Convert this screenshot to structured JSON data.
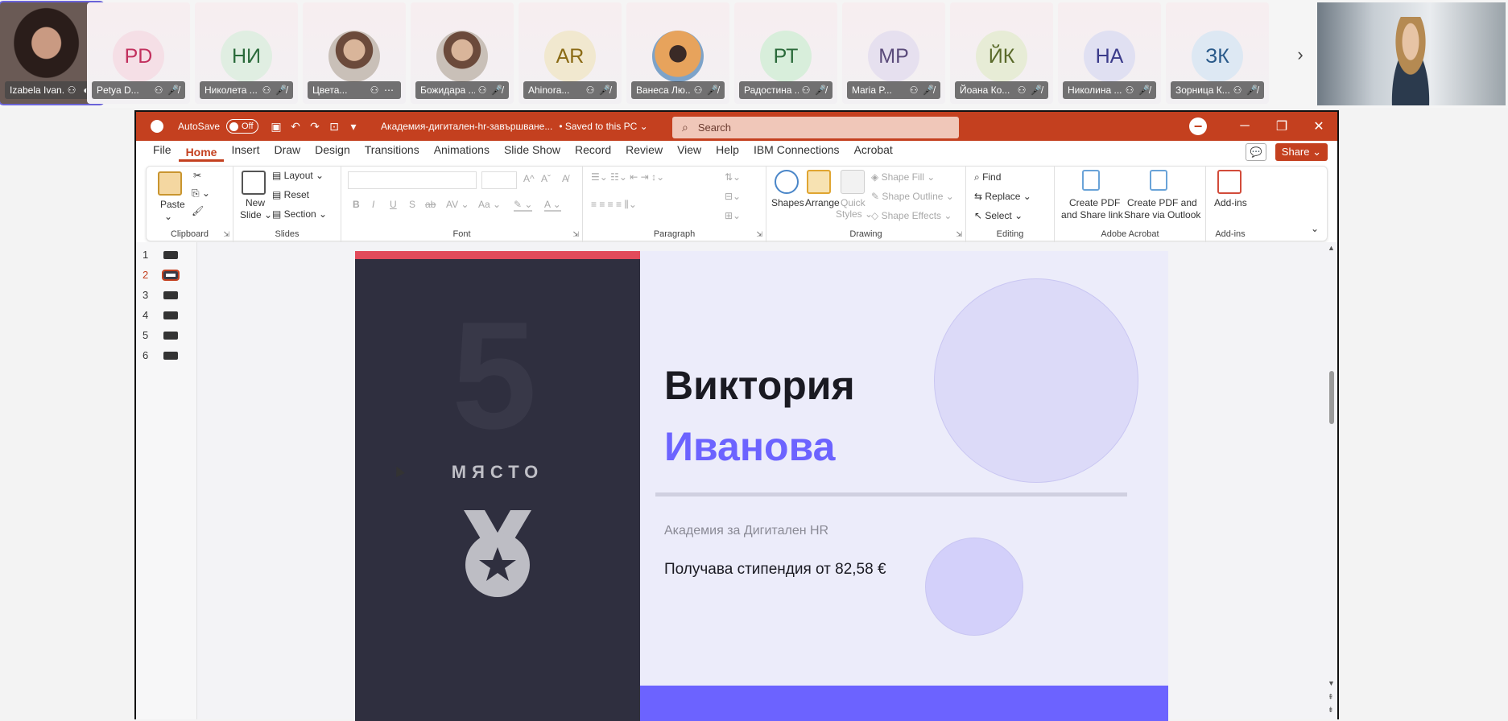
{
  "participants": [
    {
      "initials": "",
      "name": "Izabela Ivan...",
      "kind": "video",
      "mic": "◐"
    },
    {
      "initials": "PD",
      "name": "Petya D...",
      "color": "#c2305e",
      "bg": "#f5dfe6",
      "mic": "🎤̸"
    },
    {
      "initials": "НИ",
      "name": "Николета ...",
      "color": "#2a6a3a",
      "bg": "#e0eee2",
      "mic": "🎤̸"
    },
    {
      "initials": "",
      "name": "Цвета...",
      "kind": "photo",
      "mic": "⋯"
    },
    {
      "initials": "",
      "name": "Божидара ...",
      "kind": "photo",
      "mic": "🎤̸"
    },
    {
      "initials": "AR",
      "name": "Ahinora...",
      "color": "#8a6a14",
      "bg": "#f1e8cf",
      "mic": "🎤̸"
    },
    {
      "initials": "",
      "name": "Ванеса Лю...",
      "kind": "sunset",
      "mic": "🎤̸"
    },
    {
      "initials": "РТ",
      "name": "Радостина ...",
      "color": "#2a6a3a",
      "bg": "#d8eedb",
      "mic": "🎤̸"
    },
    {
      "initials": "МР",
      "name": "Maria P...",
      "color": "#5a4a7a",
      "bg": "#e6e0ef",
      "mic": "🎤̸"
    },
    {
      "initials": "ЙК",
      "name": "Йоана Ко...",
      "color": "#5a6a2a",
      "bg": "#e7ecd6",
      "mic": "🎤̸"
    },
    {
      "initials": "НА",
      "name": "Николина ...",
      "color": "#3a3a8a",
      "bg": "#e0e0f2",
      "mic": "🎤̸"
    },
    {
      "initials": "ЗК",
      "name": "Зорница К...",
      "color": "#2a5a8a",
      "bg": "#dde8f3",
      "mic": "🎤̸"
    }
  ],
  "strip_next_icon": "›",
  "titlebar": {
    "autosave_label": "AutoSave",
    "toggle_label": "Off",
    "doc_title": "Академия-дигитален-hr-завършване...",
    "saved_status": "• Saved to this PC ⌄",
    "search_placeholder": "Search",
    "minimize": "─",
    "restore": "❐",
    "close": "✕",
    "recording_icon": "−"
  },
  "menu": {
    "items": [
      "File",
      "Home",
      "Insert",
      "Draw",
      "Design",
      "Transitions",
      "Animations",
      "Slide Show",
      "Record",
      "Review",
      "View",
      "Help",
      "IBM Connections",
      "Acrobat"
    ],
    "selected": "Home",
    "share_label": "Share ⌄",
    "comment_icon": "💬"
  },
  "ribbon": {
    "clipboard": {
      "paste": "Paste",
      "label": "Clipboard"
    },
    "slides": {
      "new_slide": "New",
      "new_slide2": "Slide ⌄",
      "layout": "Layout ⌄",
      "reset": "Reset",
      "section": "Section ⌄",
      "label": "Slides"
    },
    "font": {
      "label": "Font",
      "bold": "B",
      "italic": "I",
      "underline": "U",
      "strike": "S",
      "ab": "ab",
      "av": "AV ⌄",
      "aa": "Aa ⌄",
      "grow": "A^",
      "shrink": "Aˇ"
    },
    "paragraph": {
      "label": "Paragraph"
    },
    "drawing": {
      "shapes": "Shapes",
      "arrange": "Arrange",
      "quick": "Quick",
      "styles": "Styles ⌄",
      "fill": "Shape Fill ⌄",
      "outline": "Shape Outline ⌄",
      "effects": "Shape Effects ⌄",
      "label": "Drawing"
    },
    "editing": {
      "find": "Find",
      "replace": "Replace",
      "select": "Select ⌄",
      "label": "Editing"
    },
    "acrobat": {
      "create1a": "Create PDF",
      "create1b": "and Share link",
      "create2a": "Create PDF and",
      "create2b": "Share via Outlook",
      "label": "Adobe Acrobat"
    },
    "addins": {
      "btn": "Add-ins",
      "label": "Add-ins"
    }
  },
  "thumbnails": [
    "1",
    "2",
    "3",
    "4",
    "5",
    "6"
  ],
  "selected_slide": "2",
  "slide": {
    "number": "5",
    "place": "МЯСТО",
    "first_name": "Виктория",
    "last_name": "Иванова",
    "organization": "Академия за Дигитален HR",
    "award": "Получава стипендия от 82,58 €"
  },
  "colors": {
    "accent": "#c4401f",
    "slide_dark": "#2f2f3f",
    "slide_purple": "#6c63ff",
    "slide_red": "#e24b5b"
  }
}
